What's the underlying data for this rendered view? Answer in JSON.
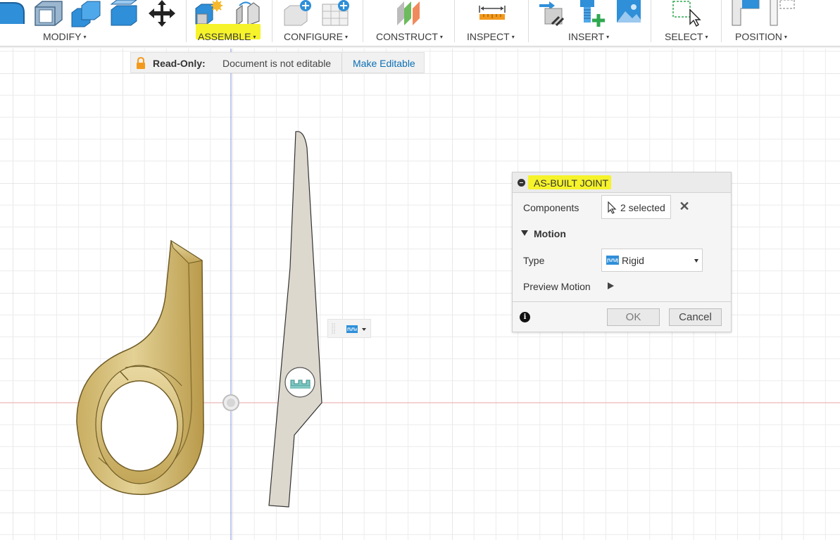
{
  "toolbar": {
    "groups": [
      {
        "id": "modify",
        "label": "MODIFY"
      },
      {
        "id": "assemble",
        "label": "ASSEMBLE"
      },
      {
        "id": "configure",
        "label": "CONFIGURE"
      },
      {
        "id": "construct",
        "label": "CONSTRUCT"
      },
      {
        "id": "inspect",
        "label": "INSPECT"
      },
      {
        "id": "insert",
        "label": "INSERT"
      },
      {
        "id": "select",
        "label": "SELECT"
      },
      {
        "id": "position",
        "label": "POSITION"
      }
    ],
    "caret": "▾",
    "highlight_color": "#f6f32a"
  },
  "banner": {
    "label": "Read-Only:",
    "message": "Document is not editable",
    "link": "Make Editable",
    "link_color": "#0a6fb4"
  },
  "dialog": {
    "title": "AS-BUILT JOINT",
    "components_label": "Components",
    "components_value": "2 selected",
    "clear_symbol": "✕",
    "motion_label": "Motion",
    "type_label": "Type",
    "type_value": "Rigid",
    "preview_label": "Preview Motion",
    "info_symbol": "i",
    "ok": "OK",
    "cancel": "Cancel"
  },
  "colors": {
    "part_gold": "#d8c384",
    "part_gold_dark": "#8a7333",
    "part_gray": "#dcd8cd",
    "grid": "#e2e2e2",
    "axis_red": "#e8a3a3",
    "axis_blue": "#7c8fd6",
    "icon_blue": "#2f8fd8"
  }
}
